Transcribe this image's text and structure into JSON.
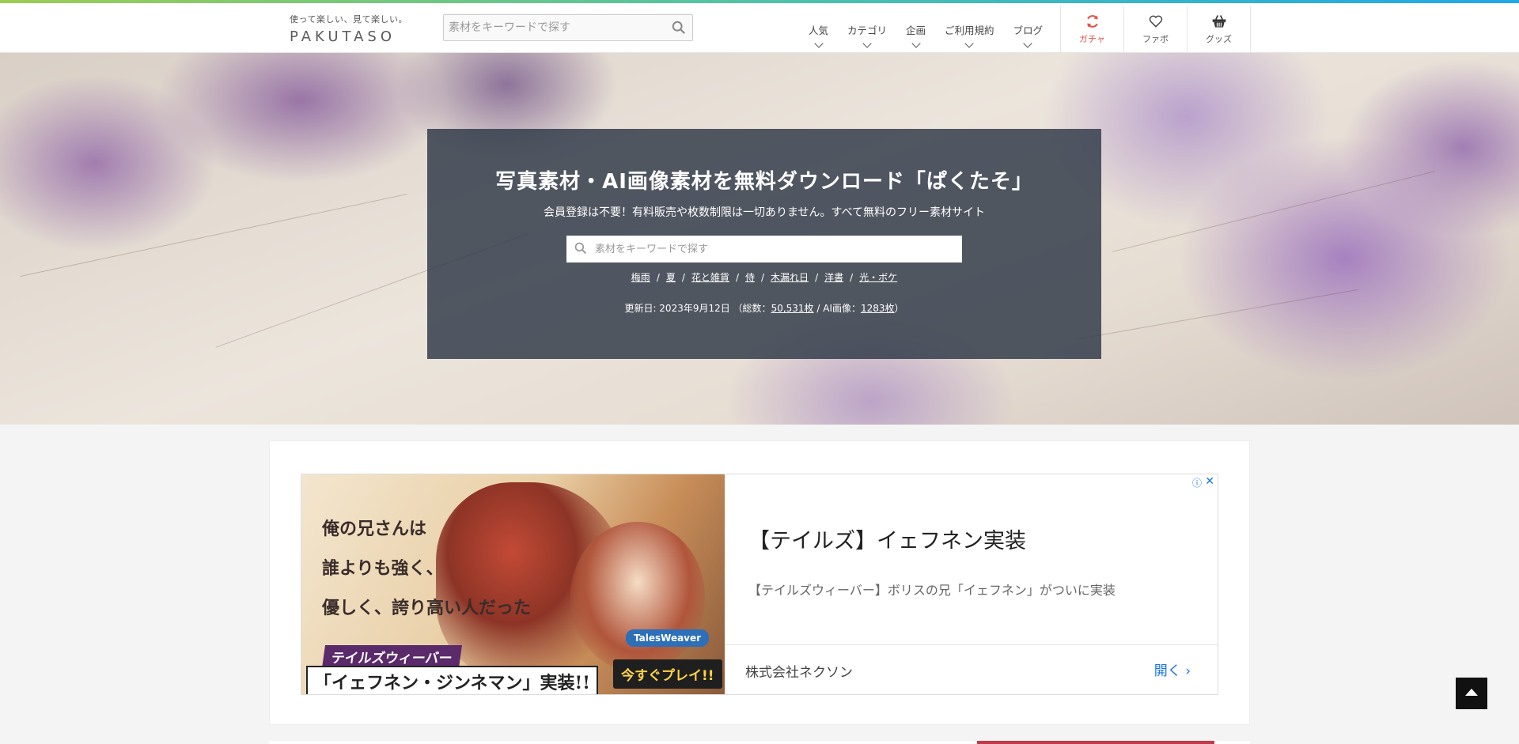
{
  "header": {
    "logo_tagline": "使って楽しい、見て楽しい。",
    "logo_word": "PAKUTASO",
    "search_placeholder": "素材をキーワードで探す",
    "nav": [
      {
        "label": "人気"
      },
      {
        "label": "カテゴリ"
      },
      {
        "label": "企画"
      },
      {
        "label": "ご利用規約"
      },
      {
        "label": "ブログ"
      }
    ],
    "icon_buttons": [
      {
        "label": "ガチャ",
        "icon": "refresh-icon"
      },
      {
        "label": "ファボ",
        "icon": "heart-icon"
      },
      {
        "label": "グッズ",
        "icon": "basket-icon"
      }
    ]
  },
  "hero": {
    "title": "写真素材・AI画像素材を無料ダウンロード「ぱくたそ」",
    "subtitle": "会員登録は不要！有料販売や枚数制限は一切ありません。すべて無料のフリー素材サイト",
    "search_placeholder": "素材をキーワードで探す",
    "tags": [
      "梅雨",
      "夏",
      "花と雑貨",
      "侍",
      "木漏れ日",
      "洋書",
      "光・ボケ"
    ],
    "update_prefix": "更新日: 2023年9月12日 （総数：",
    "total_count": "50,531枚",
    "update_mid": " / AI画像：",
    "ai_count": "1283枚",
    "update_suffix": "）"
  },
  "ad": {
    "image_lines": [
      "俺の兄さんは",
      "誰よりも強く、",
      "優しく、誇り高い人だった"
    ],
    "image_banner1": "テイルズウィーバー",
    "image_banner2": "「イェフネン・ジンネマン」実装!!",
    "image_logo": "TalesWeaver",
    "image_play": "今すぐプレイ!!",
    "title": "【テイルズ】イェフネン実装",
    "description": "【テイルズウィーバー】ボリスの兄「イェフネン」がついに実装",
    "advertiser": "株式会社ネクソン",
    "open_label": "開く",
    "info_glyph": "ⓘ",
    "close_glyph": "✕"
  },
  "colors": {
    "overlay": "#2d3746",
    "gacha": "#e4554a",
    "ad_link": "#1a73e8"
  }
}
